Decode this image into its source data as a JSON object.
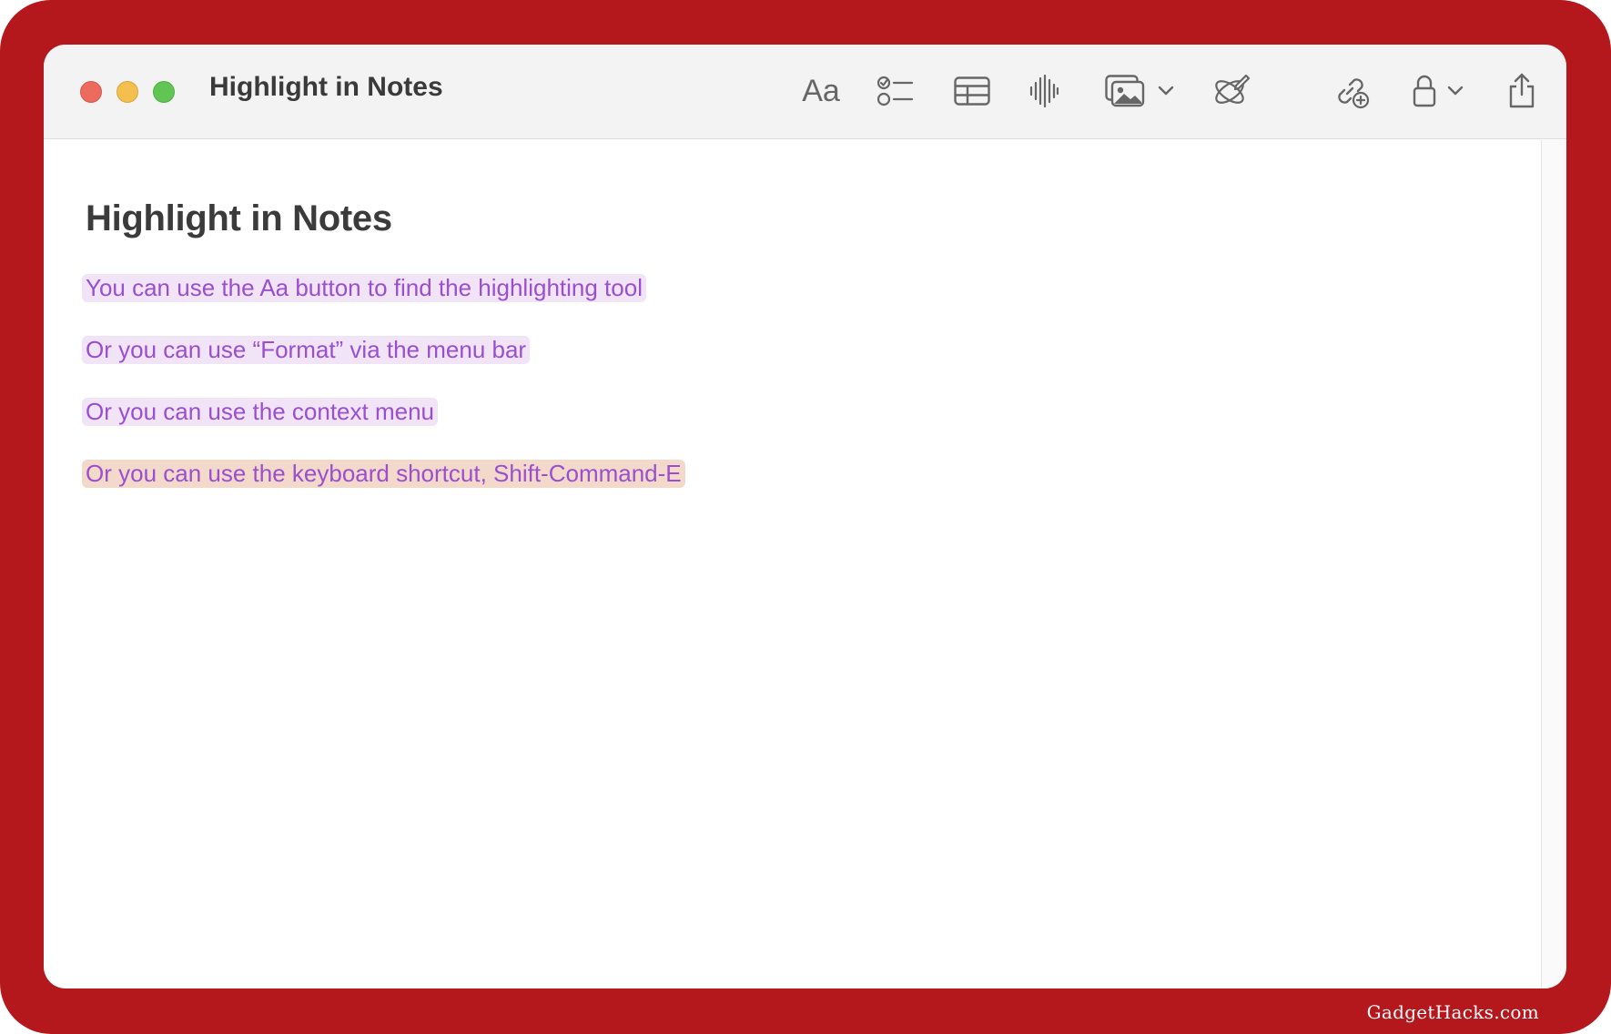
{
  "window": {
    "title": "Highlight in Notes"
  },
  "toolbar": {
    "format_label": "Aa",
    "items": [
      {
        "name": "format",
        "icon": "format-aa-icon"
      },
      {
        "name": "checklist",
        "icon": "checklist-icon"
      },
      {
        "name": "table",
        "icon": "table-icon"
      },
      {
        "name": "audio",
        "icon": "waveform-icon"
      },
      {
        "name": "media",
        "icon": "photo-icon"
      },
      {
        "name": "writing-tools",
        "icon": "writing-tools-icon"
      },
      {
        "name": "collaborate",
        "icon": "collaborate-link-icon"
      },
      {
        "name": "lock",
        "icon": "lock-icon"
      },
      {
        "name": "share",
        "icon": "share-icon"
      }
    ]
  },
  "note": {
    "heading": "Highlight in Notes",
    "lines": [
      {
        "text": "You can use the Aa button to find the highlighting tool",
        "highlight": "purple"
      },
      {
        "text": "Or you can use “Format” via the menu bar",
        "highlight": "purple"
      },
      {
        "text": "Or you can use the context menu",
        "highlight": "purple"
      },
      {
        "text": "Or you can use the keyboard shortcut, Shift-Command-E",
        "highlight": "orange"
      }
    ]
  },
  "colors": {
    "frame": "#b4171c",
    "highlight_text": "#9a4fd0",
    "highlight_purple_bg": "#f1e4f7",
    "highlight_orange_bg": "#f3d9ca",
    "traffic_close": "#ed6a5e",
    "traffic_minimize": "#f5bf4f",
    "traffic_maximize": "#61c554"
  },
  "watermark": "GadgetHacks.com"
}
